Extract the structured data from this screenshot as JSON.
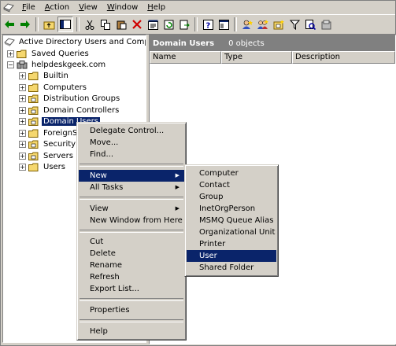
{
  "menubar": {
    "items": [
      {
        "label": "File",
        "key": "F",
        "rest": "ile"
      },
      {
        "label": "Action",
        "key": "A",
        "rest": "ction"
      },
      {
        "label": "View",
        "key": "V",
        "rest": "iew"
      },
      {
        "label": "Window",
        "key": "W",
        "rest": "indow"
      },
      {
        "label": "Help",
        "key": "H",
        "rest": "elp"
      }
    ]
  },
  "toolbar": {
    "icons": [
      "back-arrow-icon",
      "forward-arrow-icon",
      "up-folder-icon",
      "show-tree-icon",
      "cut-icon",
      "copy-icon",
      "paste-icon",
      "delete-icon",
      "properties-icon",
      "refresh-icon",
      "export-icon",
      "help-icon",
      "console-icon",
      "new-user-icon",
      "new-group-icon",
      "new-ou-icon",
      "filter-icon",
      "find-icon",
      "policy-icon"
    ]
  },
  "tree": {
    "root": "Active Directory Users and Computer",
    "saved_queries": "Saved Queries",
    "domain": "helpdeskgeek.com",
    "children": [
      "Builtin",
      "Computers",
      "Distribution Groups",
      "Domain Controllers",
      "Domain Users",
      "ForeignSe",
      "Security G",
      "Servers",
      "Users"
    ]
  },
  "right_pane": {
    "title": "Domain Users",
    "count": "0 objects",
    "columns": [
      "Name",
      "Type",
      "Description"
    ]
  },
  "context_menu": {
    "items": [
      "Delegate Control...",
      "Move...",
      "Find...",
      "New",
      "All Tasks",
      "View",
      "New Window from Here",
      "Cut",
      "Delete",
      "Rename",
      "Refresh",
      "Export List...",
      "Properties",
      "Help"
    ]
  },
  "new_submenu": {
    "items": [
      "Computer",
      "Contact",
      "Group",
      "InetOrgPerson",
      "MSMQ Queue Alias",
      "Organizational Unit",
      "Printer",
      "User",
      "Shared Folder"
    ]
  },
  "colors": {
    "highlight": "#0a246a",
    "face": "#d4d0c8",
    "header_gray": "#808080"
  }
}
